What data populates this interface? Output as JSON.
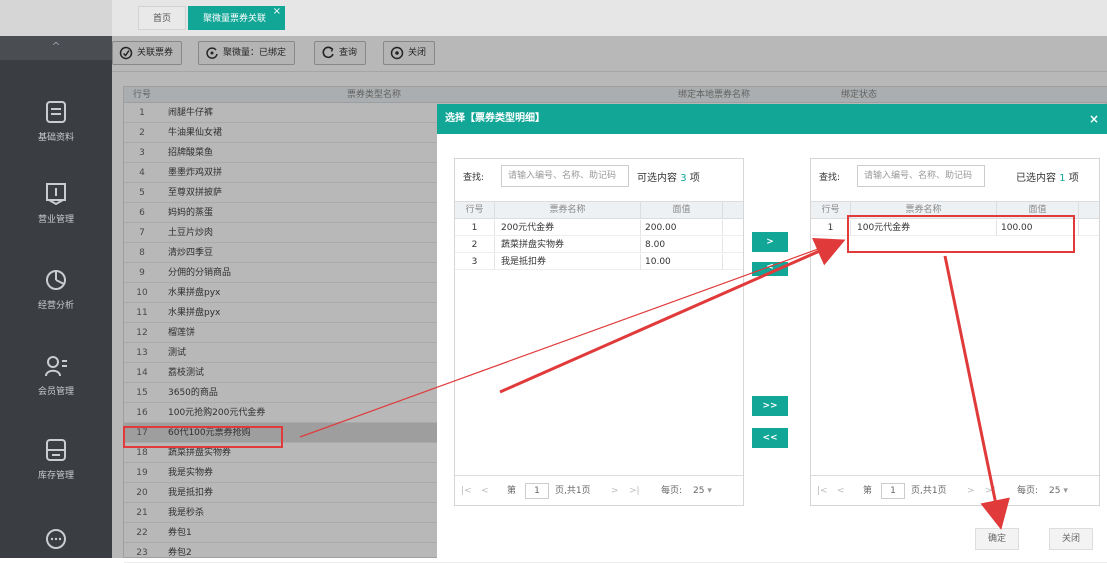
{
  "tabs": [
    {
      "label": "首页",
      "active": false
    },
    {
      "label": "聚微量票券关联",
      "active": true
    }
  ],
  "toolbar": {
    "link_label": "关联票券",
    "filter_label": "聚微量：已绑定",
    "query_label": "查询",
    "close_label": "关闭"
  },
  "sidebar": {
    "collapse_glyph": "^",
    "items": [
      {
        "label": "基础资料",
        "icon": "document-icon"
      },
      {
        "label": "营业管理",
        "icon": "receipt-icon"
      },
      {
        "label": "经营分析",
        "icon": "pie-chart-icon"
      },
      {
        "label": "会员管理",
        "icon": "member-icon"
      },
      {
        "label": "库存管理",
        "icon": "inventory-icon"
      },
      {
        "label": "",
        "icon": "chat-icon"
      }
    ]
  },
  "grid": {
    "headers": [
      "行号",
      "票券类型名称",
      "绑定本地票券名称",
      "绑定状态"
    ],
    "rows": [
      {
        "n": "1",
        "name": "闹腿牛仔裤"
      },
      {
        "n": "2",
        "name": "牛油果仙女裙"
      },
      {
        "n": "3",
        "name": "招牌酸菜鱼"
      },
      {
        "n": "4",
        "name": "墨墨炸鸡双拼"
      },
      {
        "n": "5",
        "name": "至尊双拼披萨"
      },
      {
        "n": "6",
        "name": "妈妈的蒸蛋"
      },
      {
        "n": "7",
        "name": "土豆片炒肉"
      },
      {
        "n": "8",
        "name": "清炒四季豆"
      },
      {
        "n": "9",
        "name": "分佣的分销商品"
      },
      {
        "n": "10",
        "name": "水果拼盘pyx"
      },
      {
        "n": "11",
        "name": "水果拼盘pyx"
      },
      {
        "n": "12",
        "name": "榴莲饼"
      },
      {
        "n": "13",
        "name": "测试"
      },
      {
        "n": "14",
        "name": "荔枝测试"
      },
      {
        "n": "15",
        "name": "3650的商品"
      },
      {
        "n": "16",
        "name": "100元抢购200元代金券"
      },
      {
        "n": "17",
        "name": "60代100元票券抢购",
        "selected": true
      },
      {
        "n": "18",
        "name": "蔬菜拼盘实物券"
      },
      {
        "n": "19",
        "name": "我是实物券"
      },
      {
        "n": "20",
        "name": "我是抵扣券"
      },
      {
        "n": "21",
        "name": "我是秒杀"
      },
      {
        "n": "22",
        "name": "券包1"
      },
      {
        "n": "23",
        "name": "券包2"
      }
    ]
  },
  "modal": {
    "title": "选择【票券类型明细】",
    "close_glyph": "×",
    "left": {
      "search_label": "查找:",
      "search_placeholder": "请输入编号、名称、助记码",
      "count_prefix": "可选内容",
      "count": "3",
      "count_suffix": "项",
      "headers": [
        "行号",
        "票券名称",
        "面值"
      ],
      "rows": [
        {
          "n": "1",
          "name": "200元代金券",
          "value": "200.00"
        },
        {
          "n": "2",
          "name": "蔬菜拼盘实物券",
          "value": "8.00"
        },
        {
          "n": "3",
          "name": "我是抵扣券",
          "value": "10.00"
        }
      ],
      "pager": {
        "first": "|<",
        "prev": "<",
        "page_prefix": "第",
        "page": "1",
        "page_suffix": "页,共1页",
        "next": ">",
        "last": ">|",
        "per_label": "每页:",
        "per": "25"
      }
    },
    "right": {
      "search_label": "查找:",
      "search_placeholder": "请输入编号、名称、助记码",
      "count_prefix": "已选内容",
      "count": "1",
      "count_suffix": "项",
      "headers": [
        "行号",
        "票券名称",
        "面值"
      ],
      "rows": [
        {
          "n": "1",
          "name": "100元代金券",
          "value": "100.00"
        }
      ],
      "pager": {
        "first": "|<",
        "prev": "<",
        "page_prefix": "第",
        "page": "1",
        "page_suffix": "页,共1页",
        "next": ">",
        "last": ">|",
        "per_label": "每页:",
        "per": "25"
      }
    },
    "move_buttons": [
      ">",
      "<",
      ">>",
      "<<"
    ],
    "confirm_label": "确定",
    "close_label": "关闭"
  },
  "colors": {
    "accent": "#12a697",
    "annotation": "#e03a3a",
    "sidebar": "#3a3d41"
  }
}
